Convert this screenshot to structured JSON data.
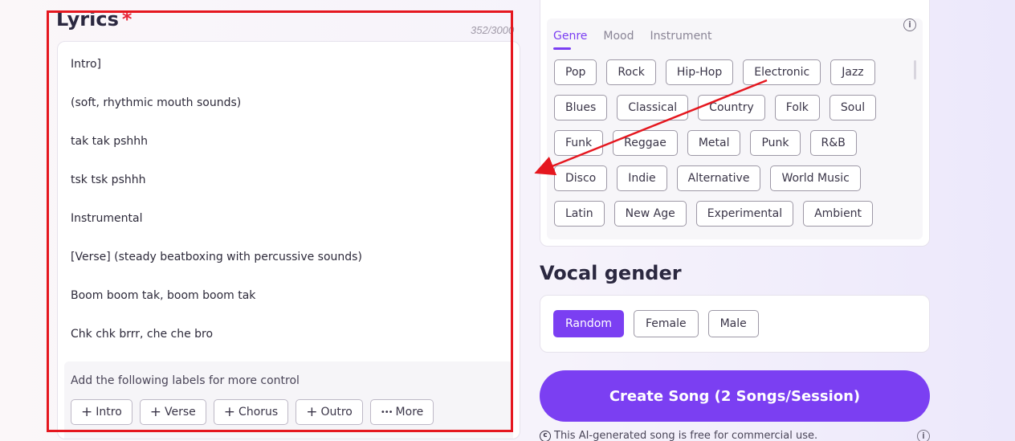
{
  "lyrics": {
    "title": "Lyrics",
    "required_mark": "*",
    "char_count": "352/3000",
    "lines": [
      "Intro]",
      "(soft, rhythmic mouth sounds)",
      "tak tak pshhh",
      "tsk tsk pshhh",
      "Instrumental",
      "[Verse] (steady beatboxing with percussive sounds)",
      "Boom boom tak, boom boom tak",
      "Chk chk brrr, che che bro"
    ],
    "labels_hint": "Add the following labels for more control",
    "label_buttons": [
      {
        "icon": "plus-icon",
        "label": "Intro"
      },
      {
        "icon": "plus-icon",
        "label": "Verse"
      },
      {
        "icon": "plus-icon",
        "label": "Chorus"
      },
      {
        "icon": "plus-icon",
        "label": "Outro"
      },
      {
        "icon": "more-dots-icon",
        "label": "More"
      }
    ]
  },
  "style": {
    "tabs": [
      "Genre",
      "Mood",
      "Instrument"
    ],
    "active_tab": "Genre",
    "genres": [
      [
        "Pop",
        "Rock",
        "Hip-Hop",
        "Electronic",
        "Jazz"
      ],
      [
        "Blues",
        "Classical",
        "Country",
        "Folk",
        "Soul"
      ],
      [
        "Funk",
        "Reggae",
        "Metal",
        "Punk",
        "R&B"
      ],
      [
        "Disco",
        "Indie",
        "Alternative",
        "World Music"
      ],
      [
        "Latin",
        "New Age",
        "Experimental",
        "Ambient"
      ]
    ]
  },
  "vocal": {
    "title": "Vocal gender",
    "options": [
      "Random",
      "Female",
      "Male"
    ],
    "selected": "Random"
  },
  "create": {
    "label": "Create Song (2 Songs/Session)",
    "note": "This AI-generated song is free for commercial use."
  },
  "colors": {
    "accent": "#7b3ff2",
    "annotation_red": "#e5171f"
  }
}
